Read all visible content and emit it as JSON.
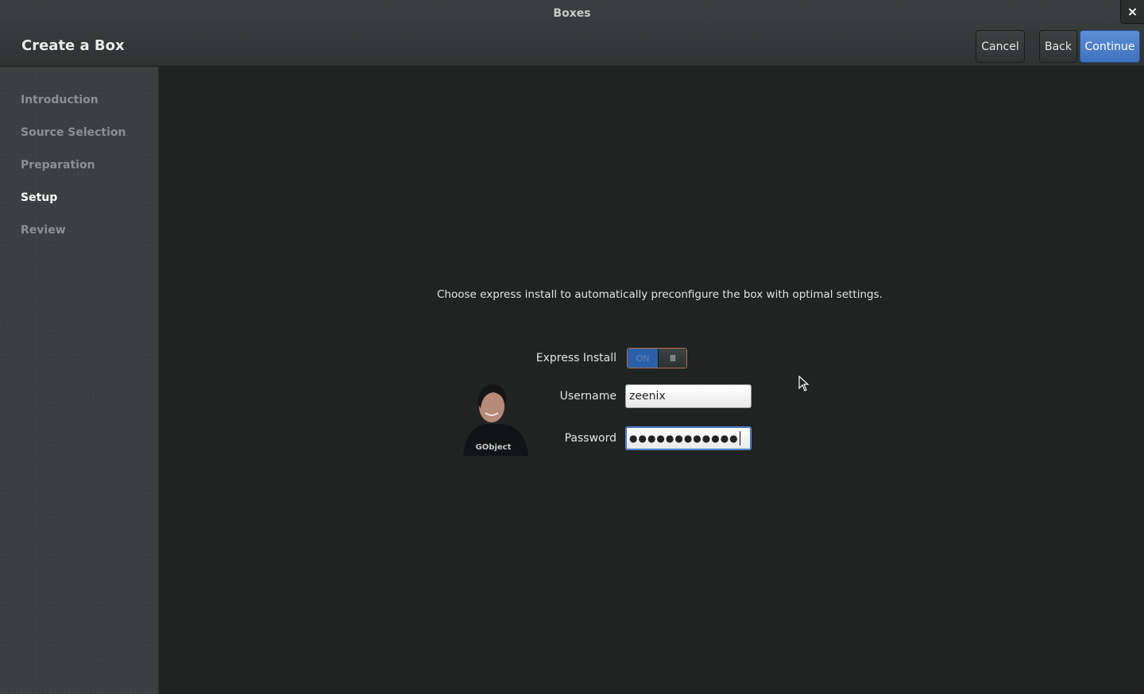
{
  "window": {
    "title": "Boxes",
    "close_icon": "×"
  },
  "header": {
    "page_title": "Create a Box",
    "cancel_label": "Cancel",
    "back_label": "Back",
    "continue_label": "Continue"
  },
  "sidebar": {
    "items": [
      {
        "label": "Introduction",
        "active": false
      },
      {
        "label": "Source Selection",
        "active": false
      },
      {
        "label": "Preparation",
        "active": false
      },
      {
        "label": "Setup",
        "active": true
      },
      {
        "label": "Review",
        "active": false
      }
    ]
  },
  "setup": {
    "description": "Choose express install to automatically preconfigure the box with optimal settings.",
    "express_install_label": "Express Install",
    "express_install_state": "ON",
    "username_label": "Username",
    "username_value": "zeenix",
    "password_label": "Password",
    "password_mask": "●●●●●●●●●●●●",
    "avatar_shirt_text": "GObject"
  },
  "colors": {
    "accent": "#3e72bf",
    "sidebar_bg": "#3a4040",
    "content_bg": "#1f2322"
  }
}
